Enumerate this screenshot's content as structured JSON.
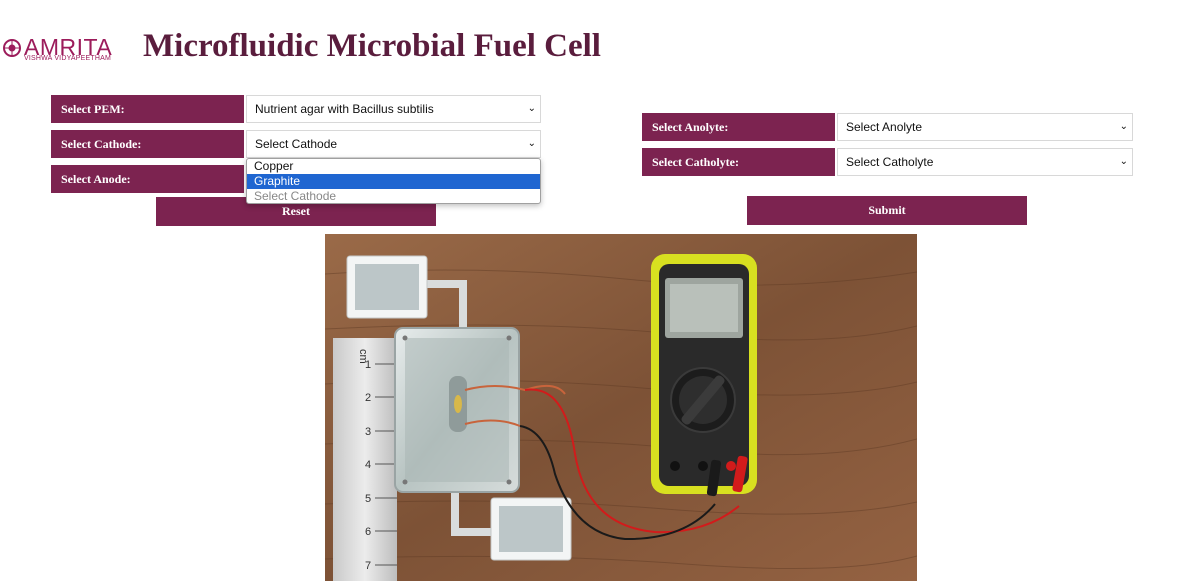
{
  "header": {
    "logo_text": "AMRITA",
    "logo_subtext": "VISHWA VIDYAPEETHAM",
    "title": "Microfluidic Microbial Fuel Cell"
  },
  "form": {
    "pem": {
      "label": "Select PEM:",
      "value": "Nutrient agar with Bacillus subtilis"
    },
    "cathode": {
      "label": "Select Cathode:",
      "value": "Select Cathode"
    },
    "anode": {
      "label": "Select Anode:"
    },
    "anolyte": {
      "label": "Select Anolyte:",
      "value": "Select Anolyte"
    },
    "catholyte": {
      "label": "Select Catholyte:",
      "value": "Select Catholyte"
    },
    "reset_label": "Reset",
    "submit_label": "Submit"
  },
  "cathode_dropdown": {
    "options": [
      {
        "label": "Copper",
        "state": "normal"
      },
      {
        "label": "Graphite",
        "state": "highlighted"
      },
      {
        "label": "Select Cathode",
        "state": "disabled"
      }
    ]
  },
  "scene": {
    "ruler_unit": "cm",
    "ruler_marks": [
      "1",
      "2",
      "3",
      "4",
      "5",
      "6",
      "7"
    ],
    "colors": {
      "table_wood": "#8a5a3b",
      "multimeter_frame": "#d8e020",
      "probe_red": "#d21b1b",
      "probe_black": "#1a1a1a"
    }
  },
  "colors": {
    "accent": "#7c2350",
    "title": "#5a1d3d",
    "logo": "#9c1c5b",
    "highlight": "#1f66d1"
  }
}
